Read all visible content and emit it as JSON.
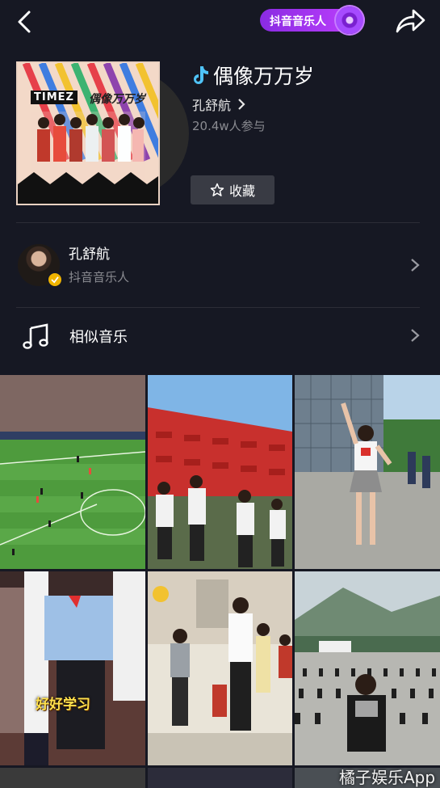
{
  "header": {
    "back_icon": "chevron-left-icon",
    "badge_label": "抖音音乐人",
    "share_icon": "share-arrow-icon"
  },
  "song": {
    "cover_brand": "TIMEZ",
    "cover_title": "偶像万万岁",
    "title": "偶像万万岁",
    "artist": "孔舒航",
    "participants": "20.4w人参与",
    "favorite_label": "收藏"
  },
  "artist_card": {
    "name": "孔舒航",
    "tag": "抖音音乐人"
  },
  "similar": {
    "label": "相似音乐"
  },
  "videos": [
    {
      "scene": "soccer-stadium"
    },
    {
      "scene": "red-pavilion-dance"
    },
    {
      "scene": "plaza-dance"
    },
    {
      "scene": "school-kids",
      "caption": "好好学习"
    },
    {
      "scene": "classroom-dance"
    },
    {
      "scene": "schoolyard-formation"
    }
  ],
  "watermark": "橘子娱乐App",
  "colors": {
    "background": "#161823",
    "badge": "#a64bff",
    "secondary_text": "#8a8b91"
  }
}
